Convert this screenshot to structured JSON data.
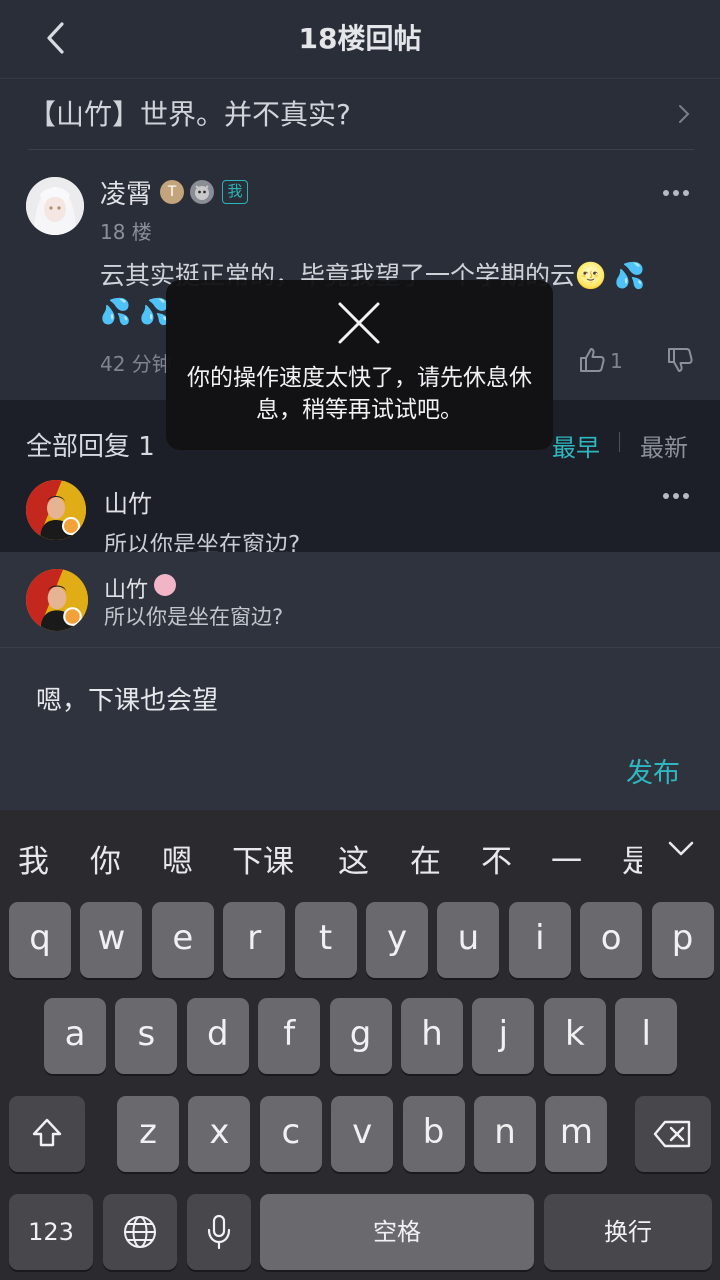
{
  "header": {
    "title": "18楼回帖"
  },
  "thread": {
    "title": "【山竹】世界。并不真实?"
  },
  "post": {
    "author": "凌霄",
    "badge_letter": "T",
    "me_label": "我",
    "floor": "18 楼",
    "body": "云其实挺正常的，毕竟我望了一个学期的云🌝 💦 💦 💦",
    "time": "42 分钟",
    "likes": "1"
  },
  "replies": {
    "title": "全部回复 1",
    "sort_early": "最早",
    "sort_new": "最新",
    "items": [
      {
        "author": "山竹",
        "text": "所以你是坐在窗边?"
      }
    ]
  },
  "quote": {
    "author": "山竹",
    "text": "所以你是坐在窗边?"
  },
  "input": {
    "value": "嗯，下课也会望",
    "publish_label": "发布"
  },
  "toast": {
    "message": "你的操作速度太快了，请先休息休息，稍等再试试吧。"
  },
  "keyboard": {
    "candidates": [
      "我",
      "你",
      "嗯",
      "下课",
      "这",
      "在",
      "不",
      "一",
      "是"
    ],
    "row1": [
      "q",
      "w",
      "e",
      "r",
      "t",
      "y",
      "u",
      "i",
      "o",
      "p"
    ],
    "row2": [
      "a",
      "s",
      "d",
      "f",
      "g",
      "h",
      "j",
      "k",
      "l"
    ],
    "row3": [
      "z",
      "x",
      "c",
      "v",
      "b",
      "n",
      "m"
    ],
    "num_label": "123",
    "space_label": "空格",
    "return_label": "换行"
  },
  "colors": {
    "accent": "#2eb7c0",
    "background": "#1c1f27",
    "panel": "#2a2e38"
  }
}
